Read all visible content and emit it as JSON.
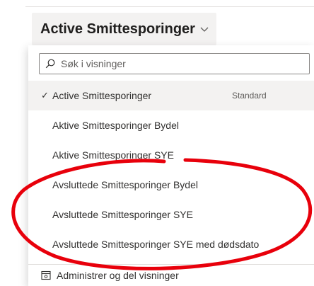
{
  "view_selector": {
    "title": "Active Smittesporinger",
    "chevron_icon": "chevron-down-icon"
  },
  "search": {
    "placeholder": "Søk i visninger",
    "icon": "search-icon"
  },
  "views": [
    {
      "label": "Active Smittesporinger",
      "selected": true,
      "badge": "Standard"
    },
    {
      "label": "Aktive Smittesporinger Bydel",
      "selected": false
    },
    {
      "label": "Aktive Smittesporinger SYE",
      "selected": false
    },
    {
      "label": "Avsluttede Smittesporinger Bydel",
      "selected": false
    },
    {
      "label": "Avsluttede Smittesporinger SYE",
      "selected": false
    },
    {
      "label": "Avsluttede Smittesporinger SYE med dødsdato",
      "selected": false
    }
  ],
  "footer": {
    "manage_label": "Administrer og del visninger",
    "icon": "manage-views-icon"
  },
  "colors": {
    "annotation_ring": "#e8000b",
    "selected_bg": "#f3f2f1"
  }
}
